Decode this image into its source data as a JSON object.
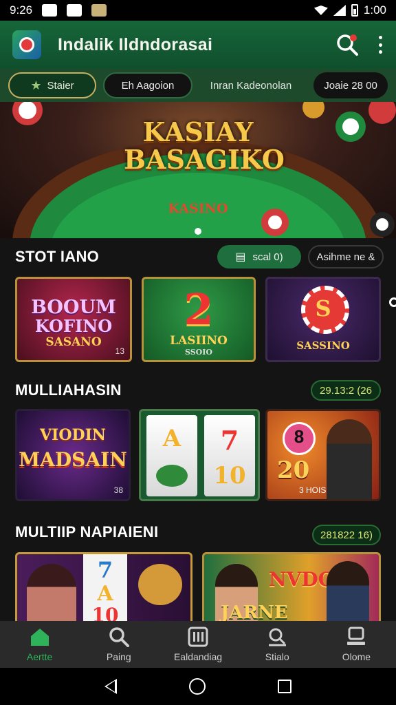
{
  "status_bar": {
    "time": "9:26",
    "battery_time": "1:00"
  },
  "app_bar": {
    "title": "Indalik Ildndorasai",
    "logo_icon": "casino-die-icon",
    "search_icon": "search-icon",
    "menu_icon": "more-vert-icon"
  },
  "filters": {
    "start": "Staier",
    "tab": "Eh Aagoion",
    "plain": "Inran Kadeonolan",
    "score": "Joaie 28 00"
  },
  "banner": {
    "title_line1": "KASIAY",
    "title_line2": "BASAGIKO",
    "table_logo": "KASINO"
  },
  "sections": [
    {
      "title": "STOT IANO",
      "actions": [
        "scal 0)",
        "Asihme ne &"
      ],
      "cards": [
        {
          "line1": "BOOUM",
          "line2": "KOFINO",
          "line3": "SASANO",
          "tag": "13"
        },
        {
          "line1": "2",
          "line2": "LASIINO",
          "line3": "SSOIO",
          "tag": ""
        },
        {
          "line1": "S",
          "line2": "SASSINO",
          "line3": "",
          "tag": ""
        }
      ]
    },
    {
      "title": "MULLIAHASIN",
      "score": "29.13:2 (26",
      "cards": [
        {
          "line1": "VIODIN",
          "line2": "MADSAIN",
          "tag": "38"
        },
        {
          "line1": "A",
          "line2": "7",
          "line3": "10",
          "tag": ""
        },
        {
          "line1": "8",
          "line2": "20",
          "line3": "3 HOISIO",
          "tag": ""
        }
      ]
    },
    {
      "title": "MULTIIP NAPIAIENI",
      "score": "281822 16)",
      "cards": [
        {
          "line1": "7",
          "line2": "A",
          "line3": "10"
        },
        {
          "line1": "NVDO",
          "line2": "JARNE"
        }
      ]
    }
  ],
  "bottom_nav": [
    {
      "label": "Aertte",
      "icon": "home-icon",
      "active": true
    },
    {
      "label": "Paing",
      "icon": "search-icon",
      "active": false
    },
    {
      "label": "Ealdandiag",
      "icon": "building-icon",
      "active": false
    },
    {
      "label": "Stialo",
      "icon": "stats-icon",
      "active": false
    },
    {
      "label": "Olome",
      "icon": "monitor-icon",
      "active": false
    }
  ],
  "colors": {
    "primary_green": "#17663a",
    "accent_gold": "#b8913a",
    "active_nav": "#2eb35a"
  }
}
